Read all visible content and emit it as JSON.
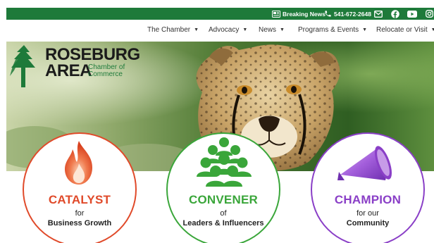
{
  "topbar": {
    "breaking_news": "Breaking News",
    "phone": "541-672-2648",
    "icons": [
      "newspaper-icon",
      "phone-icon",
      "mail-icon",
      "facebook-icon",
      "youtube-icon",
      "instagram-icon"
    ],
    "color": "#1e7a3a"
  },
  "nav": {
    "items": [
      {
        "label": "The Chamber"
      },
      {
        "label": "Advocacy"
      },
      {
        "label": "News"
      },
      {
        "label": "Programs & Events"
      },
      {
        "label": "Relocate or Visit"
      }
    ],
    "caret": "▼"
  },
  "logo": {
    "line1": "ROSEBURG",
    "line2": "AREA",
    "chamber": "Chamber of",
    "commerce": "Commerce",
    "color": "#1e7a3a"
  },
  "circles": [
    {
      "title": "CATALYST",
      "line1": "for",
      "line2": "Business Growth",
      "color": "#e04a2a",
      "icon": "flame-icon"
    },
    {
      "title": "CONVENER",
      "line1": "of",
      "line2": "Leaders & Influencers",
      "color": "#3aa63a",
      "icon": "people-group-icon"
    },
    {
      "title": "CHAMPION",
      "line1": "for our",
      "line2": "Community",
      "color": "#8a3fc7",
      "icon": "megaphone-icon"
    }
  ]
}
